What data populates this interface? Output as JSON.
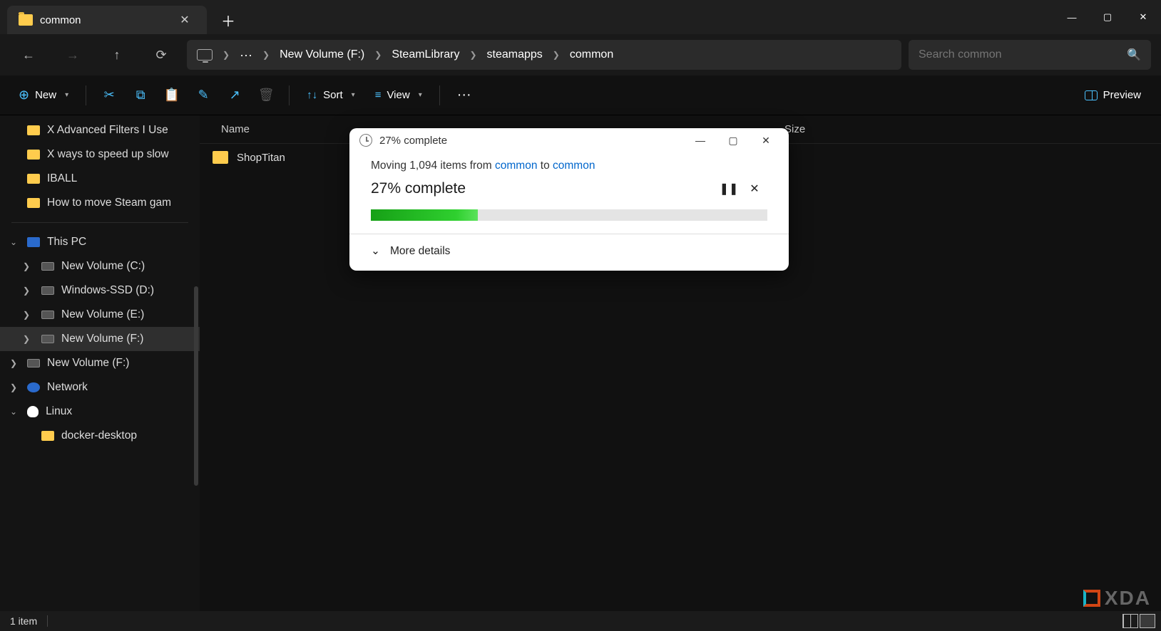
{
  "tab": {
    "title": "common"
  },
  "breadcrumb": {
    "parts": [
      "New Volume (F:)",
      "SteamLibrary",
      "steamapps",
      "common"
    ]
  },
  "search": {
    "placeholder": "Search common"
  },
  "toolbar": {
    "new_label": "New",
    "sort_label": "Sort",
    "view_label": "View",
    "preview_label": "Preview"
  },
  "sidebar": {
    "quick_items": [
      "X Advanced Filters I Use",
      "X ways to speed up slow",
      "IBALL",
      "How to move Steam gam"
    ],
    "this_pc_label": "This PC",
    "drives": [
      "New Volume (C:)",
      "Windows-SSD (D:)",
      "New Volume (E:)",
      "New Volume (F:)",
      "New Volume (F:)"
    ],
    "network_label": "Network",
    "linux_label": "Linux",
    "linux_items": [
      "docker-desktop"
    ]
  },
  "columns": {
    "name": "Name",
    "size": "Size"
  },
  "content": {
    "rows": [
      "ShopTitan"
    ]
  },
  "status": {
    "text": "1 item"
  },
  "dialog": {
    "title": "27% complete",
    "move_prefix": "Moving 1,094 items from ",
    "link_from": "common",
    "move_mid": " to ",
    "link_to": "common",
    "percent": "27% complete",
    "details_label": "More details",
    "progress_pct": 27
  },
  "watermark": {
    "text": "XDA"
  }
}
